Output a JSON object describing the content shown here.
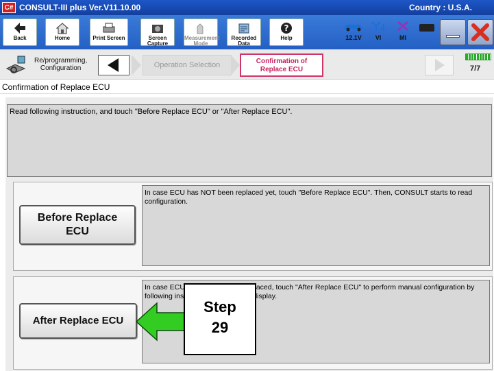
{
  "titlebar": {
    "app_title": "CONSULT-III plus  Ver.V11.10.00",
    "logo_text": "C#",
    "country": "Country : U.S.A."
  },
  "toolbar": {
    "back": "Back",
    "home": "Home",
    "print_screen": "Print Screen",
    "screen_capture": "Screen Capture",
    "measurement_mode": "Measurement Mode",
    "recorded_data": "Recorded Data",
    "help": "Help",
    "voltage": "12.1V",
    "vi_label": "VI",
    "mi_label": "MI"
  },
  "nav": {
    "crumb_label_line1": "Re/programming,",
    "crumb_label_line2": "Configuration",
    "step_operation": "Operation Selection",
    "step_confirm_line1": "Confirmation of",
    "step_confirm_line2": "Replace ECU",
    "step_count": "7/7",
    "progress_fraction": 1.0
  },
  "page": {
    "header": "Confirmation of Replace ECU"
  },
  "instruction": "Read following instruction, and touch \"Before Replace ECU\" or \"After Replace ECU\".",
  "before": {
    "button_line1": "Before Replace",
    "button_line2": "ECU",
    "description": "In case ECU has NOT been replaced yet, touch \"Before Replace ECU\". Then, CONSULT starts to read configuration."
  },
  "after": {
    "button": "After Replace ECU",
    "description": "In case ECU has been already replaced, touch \"After Replace ECU\" to perform manual configuration by following instruction of CONSULT display."
  },
  "callout": {
    "line1": "Step",
    "line2": "29"
  },
  "colors": {
    "titlebar": "#1e57c8",
    "accent_pink": "#d0336a",
    "arrow_green": "#33cc22"
  }
}
